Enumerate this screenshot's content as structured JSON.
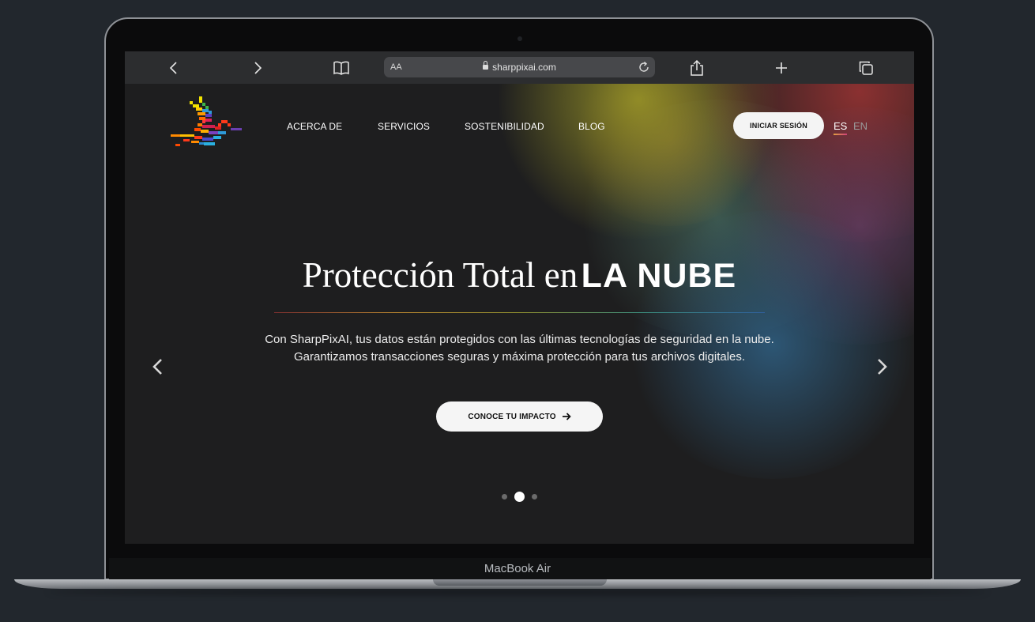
{
  "device": {
    "model_label": "MacBook Air"
  },
  "browser": {
    "aa_label": "AA",
    "url": "sharppixai.com",
    "icons": [
      "back-icon",
      "forward-icon",
      "bookmarks-icon",
      "lock-icon",
      "reload-icon",
      "share-icon",
      "new-tab-icon",
      "tabs-icon"
    ]
  },
  "nav": {
    "items": [
      {
        "label": "ACERCA DE"
      },
      {
        "label": "SERVICIOS"
      },
      {
        "label": "SOSTENIBILIDAD"
      },
      {
        "label": "BLOG"
      }
    ],
    "login_label": "INICIAR SESIÓN",
    "languages": [
      {
        "label": "ES",
        "active": true
      },
      {
        "label": "EN",
        "active": false
      }
    ]
  },
  "hero": {
    "title_serif": "Protección Total en",
    "title_sans": "LA NUBE",
    "description_line1": "Con SharpPixAI, tus datos están protegidos con las últimas tecnologías de seguridad en la nube.",
    "description_line2": "Garantizamos transacciones seguras y máxima protección para tus archivos digitales.",
    "cta_label": "CONOCE TU IMPACTO",
    "slide_count": 3,
    "active_slide": 2
  },
  "colors": {
    "page_bg": "#1e1e1f",
    "toolbar_bg": "#2c2d2f",
    "button_bg": "#f5f5f5"
  }
}
